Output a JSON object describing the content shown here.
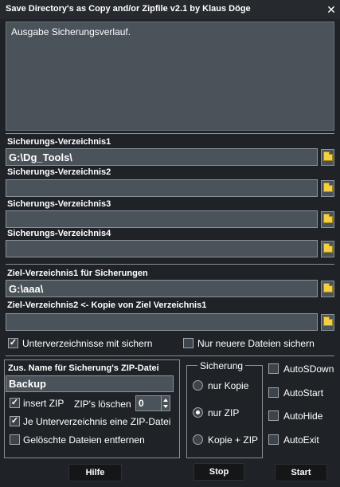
{
  "window": {
    "title": "Save Directory's as Copy and/or Zipfile v2.1 by Klaus Döge",
    "close_glyph": "✕"
  },
  "log": {
    "text": "Ausgabe Sicherungsverlauf."
  },
  "sources": [
    {
      "label": "Sicherungs-Verzeichnis1",
      "value": "G:\\Dg_Tools\\"
    },
    {
      "label": "Sicherungs-Verzeichnis2",
      "value": ""
    },
    {
      "label": "Sicherungs-Verzeichnis3",
      "value": ""
    },
    {
      "label": "Sicherungs-Verzeichnis4",
      "value": ""
    }
  ],
  "targets": [
    {
      "label": "Ziel-Verzeichnis1 für Sicherungen",
      "value": "G:\\aaa\\"
    },
    {
      "label": "Ziel-Verzeichnis2 <- Kopie von Ziel Verzeichnis1",
      "value": ""
    }
  ],
  "options": {
    "subdirs": {
      "label": "Unterverzeichnisse mit sichern",
      "checked": true
    },
    "newer_only": {
      "label": "Nur neuere Dateien sichern",
      "checked": false
    }
  },
  "zip_panel": {
    "title": "Zus. Name für Sicherung's ZIP-Datei",
    "name_value": "Backup",
    "insert_zip": {
      "label": "insert ZIP",
      "checked": true
    },
    "zip_delete_label": "ZIP's löschen",
    "zip_delete_value": "0",
    "per_subdir": {
      "label": "Je Unterverzeichnis eine ZIP-Datei",
      "checked": true
    },
    "deleted_files": {
      "label": "Gelöschte Dateien entfernen",
      "checked": false
    }
  },
  "backup_mode": {
    "title": "Sicherung",
    "options": [
      "nur Kopie",
      "nur ZIP",
      "Kopie + ZIP"
    ],
    "selected": "nur ZIP"
  },
  "auto": [
    {
      "label": "AutoSDown",
      "checked": false
    },
    {
      "label": "AutoStart",
      "checked": false
    },
    {
      "label": "AutoHide",
      "checked": false
    },
    {
      "label": "AutoExit",
      "checked": false
    }
  ],
  "buttons": {
    "help": "Hilfe",
    "stop": "Stop",
    "start": "Start"
  },
  "checkmark": "✓",
  "colors": {
    "background": "#1f2328",
    "field": "#4a525a",
    "folder": "#f2d045",
    "button": "#141618"
  }
}
